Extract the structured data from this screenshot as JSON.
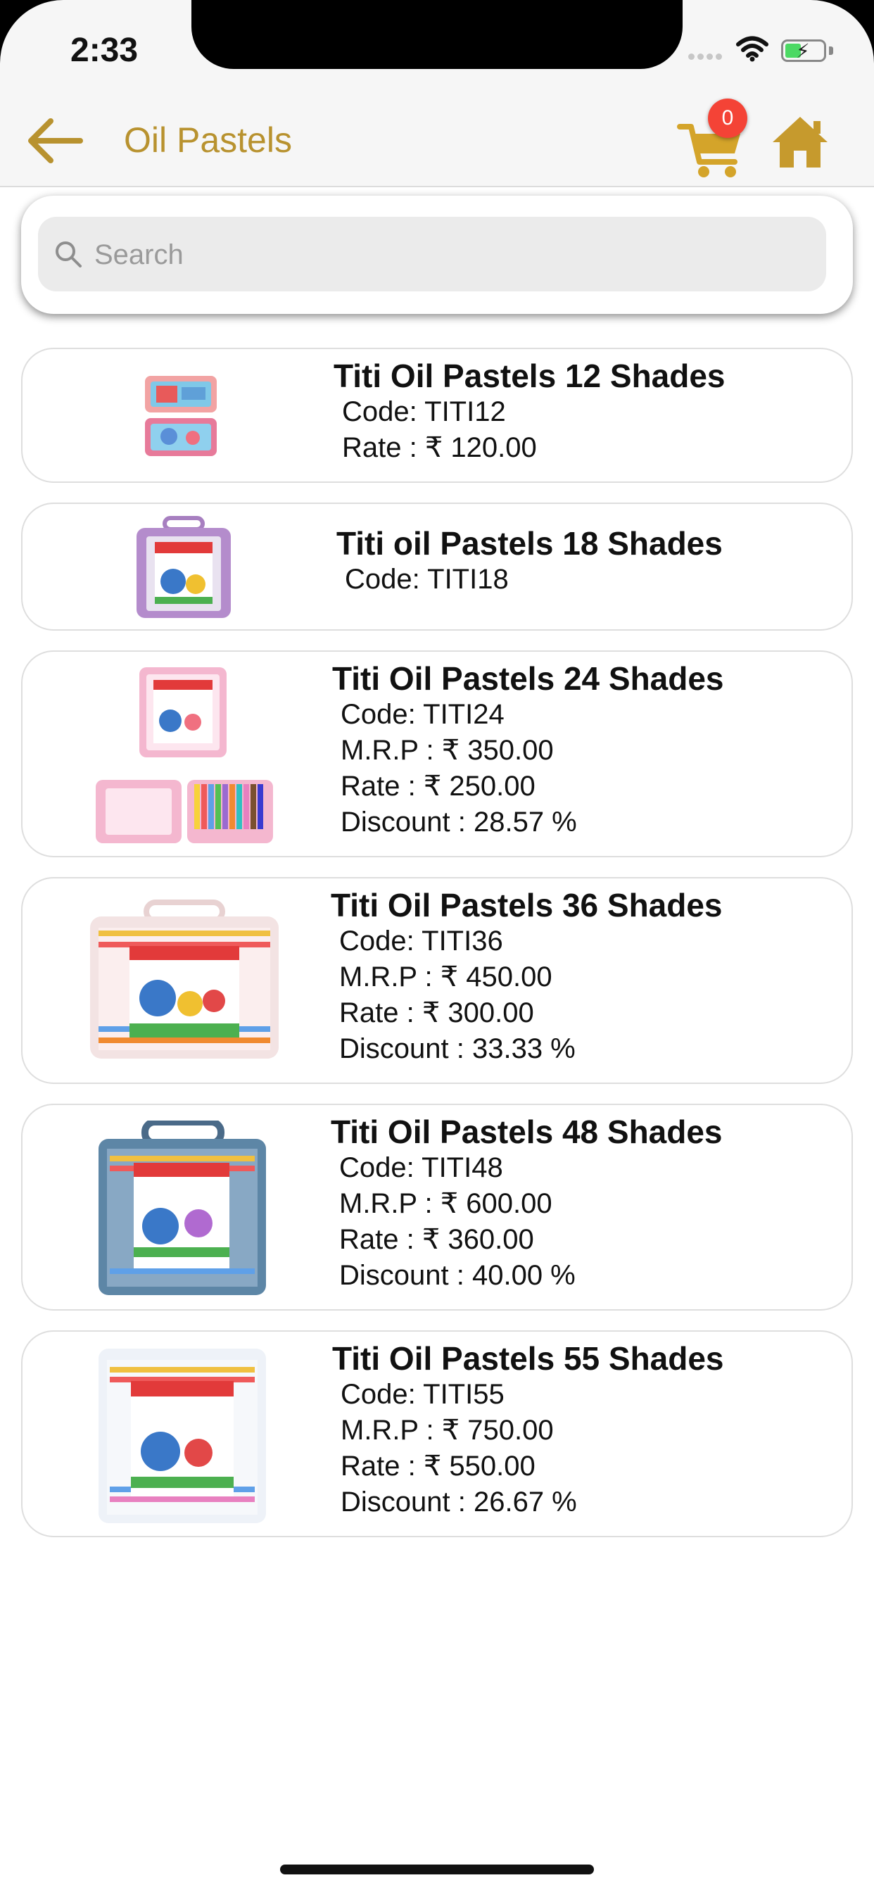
{
  "status_bar": {
    "time": "2:33"
  },
  "nav": {
    "title": "Oil Pastels",
    "cart_count": "0"
  },
  "search": {
    "placeholder": "Search",
    "value": ""
  },
  "products": [
    {
      "name": "Titi Oil Pastels 12 Shades",
      "lines": [
        "Code: TITI12",
        "Rate : ₹ 120.00"
      ]
    },
    {
      "name": "Titi oil Pastels 18 Shades",
      "lines": [
        "Code: TITI18"
      ]
    },
    {
      "name": "Titi Oil Pastels 24 Shades",
      "lines": [
        "Code: TITI24",
        "M.R.P : ₹ 350.00",
        "Rate : ₹ 250.00",
        "Discount : 28.57 %"
      ]
    },
    {
      "name": "Titi Oil Pastels 36 Shades",
      "lines": [
        "Code: TITI36",
        "M.R.P : ₹ 450.00",
        "Rate : ₹ 300.00",
        "Discount : 33.33 %"
      ]
    },
    {
      "name": "Titi Oil Pastels 48 Shades",
      "lines": [
        "Code: TITI48",
        "M.R.P : ₹ 600.00",
        "Rate : ₹ 360.00",
        "Discount : 40.00 %"
      ]
    },
    {
      "name": "Titi Oil Pastels 55 Shades",
      "lines": [
        "Code: TITI55",
        "M.R.P : ₹ 750.00",
        "Rate : ₹ 550.00",
        "Discount : 26.67 %"
      ]
    }
  ],
  "colors": {
    "accent": "#b8922f",
    "badge": "#f44336"
  }
}
